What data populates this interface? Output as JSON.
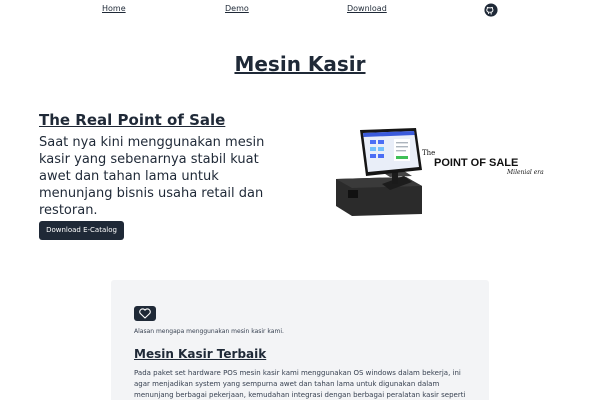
{
  "nav": {
    "home": "Home",
    "demo": "Demo",
    "download": "Download",
    "github_icon": "github-icon"
  },
  "page_title": "Mesin Kasir",
  "hero": {
    "title": "The Real Point of Sale",
    "text": "Saat nya kini menggunakan mesin kasir yang sebenarnya stabil kuat awet dan tahan lama untuk menunjang bisnis usaha retail dan restoran.",
    "button": "Download E-Catalog",
    "image_tag_small": "The",
    "image_tag_big": "POINT OF SALE",
    "image_tag_sub": "Milenial era"
  },
  "feature": {
    "icon": "heart-icon",
    "caption": "Alasan mengapa menggunakan mesin kasir kami.",
    "title": "Mesin Kasir Terbaik",
    "body": "Pada paket set hardware POS mesin kasir kami menggunakan OS windows dalam bekerja, ini agar menjadikan system yang sempurna awet dan tahan lama untuk digunakan dalam menunjang berbagai pekerjaan, kemudahan integrasi dengan berbagai peralatan kasir seperti"
  },
  "colors": {
    "dark": "#1f2937",
    "card_bg": "#f3f4f6"
  }
}
